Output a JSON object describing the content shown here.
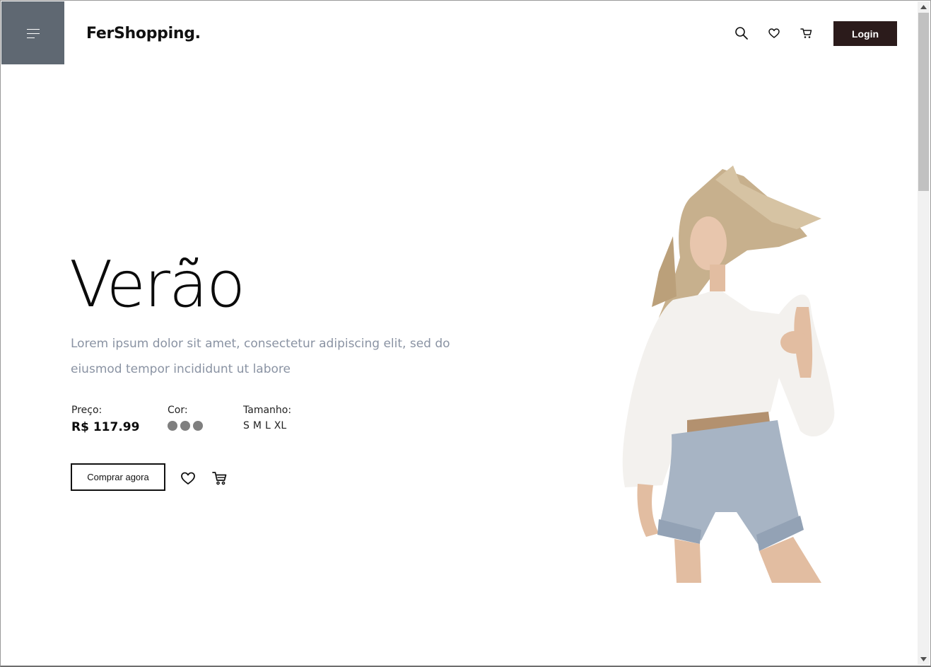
{
  "header": {
    "brand": "FerShopping.",
    "login_label": "Login",
    "icons": [
      "menu-icon",
      "search-icon",
      "heart-icon",
      "cart-icon"
    ]
  },
  "hero": {
    "title": "Verão",
    "description": "Lorem ipsum dolor sit amet, consectetur adipiscing elit, sed do eiusmod tempor incididunt ut labore",
    "price_label": "Preço:",
    "price_value": "R$ 117.99",
    "color_label": "Cor:",
    "color_swatches": [
      "#7f7f7f",
      "#7f7f7f",
      "#7f7f7f"
    ],
    "size_label": "Tamanho:",
    "sizes": [
      "S",
      "M",
      "L",
      "XL"
    ],
    "buy_label": "Comprar agora",
    "action_icons": [
      "heart-icon",
      "cart-icon"
    ]
  },
  "colors": {
    "menu_box": "#5f6872",
    "login_bg": "#2b1b1b",
    "description_text": "#8a93a3"
  }
}
